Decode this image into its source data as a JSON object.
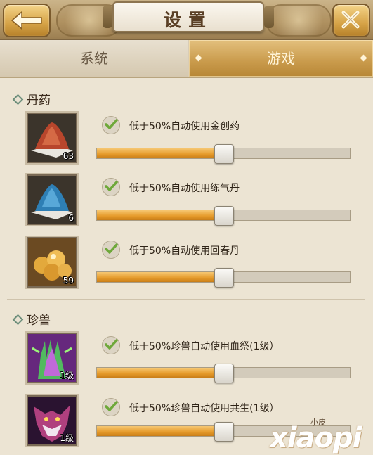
{
  "header": {
    "title": "设置",
    "back_icon": "back-arrow-icon",
    "close_icon": "close-x-icon"
  },
  "tabs": [
    {
      "label": "系统",
      "active": false
    },
    {
      "label": "游戏",
      "active": true
    }
  ],
  "sections": [
    {
      "title": "丹药",
      "items": [
        {
          "icon": "red-powder-icon",
          "count": "63",
          "checked": true,
          "label": "低于50%自动使用金创药",
          "slider_fraction": 0.5
        },
        {
          "icon": "blue-powder-icon",
          "count": "6",
          "checked": true,
          "label": "低于50%自动使用练气丹",
          "slider_fraction": 0.5
        },
        {
          "icon": "golden-pills-icon",
          "count": "59",
          "checked": true,
          "label": "低于50%自动使用回春丹",
          "slider_fraction": 0.5
        }
      ]
    },
    {
      "title": "珍兽",
      "items": [
        {
          "icon": "green-claw-skill-icon",
          "count": "1级",
          "checked": true,
          "label": "低于50%珍兽自动使用血祭(1级）",
          "slider_fraction": 0.5
        },
        {
          "icon": "wolf-skill-icon",
          "count": "1级",
          "checked": true,
          "label": "低于50%珍兽自动使用共生(1级）",
          "slider_fraction": 0.5
        }
      ]
    }
  ],
  "colors": {
    "accent_gold": "#e59a2a",
    "check_green": "#6ea83a",
    "background": "#ece4d3"
  },
  "watermark": {
    "main": "xiaopi",
    "small": "小皮"
  }
}
